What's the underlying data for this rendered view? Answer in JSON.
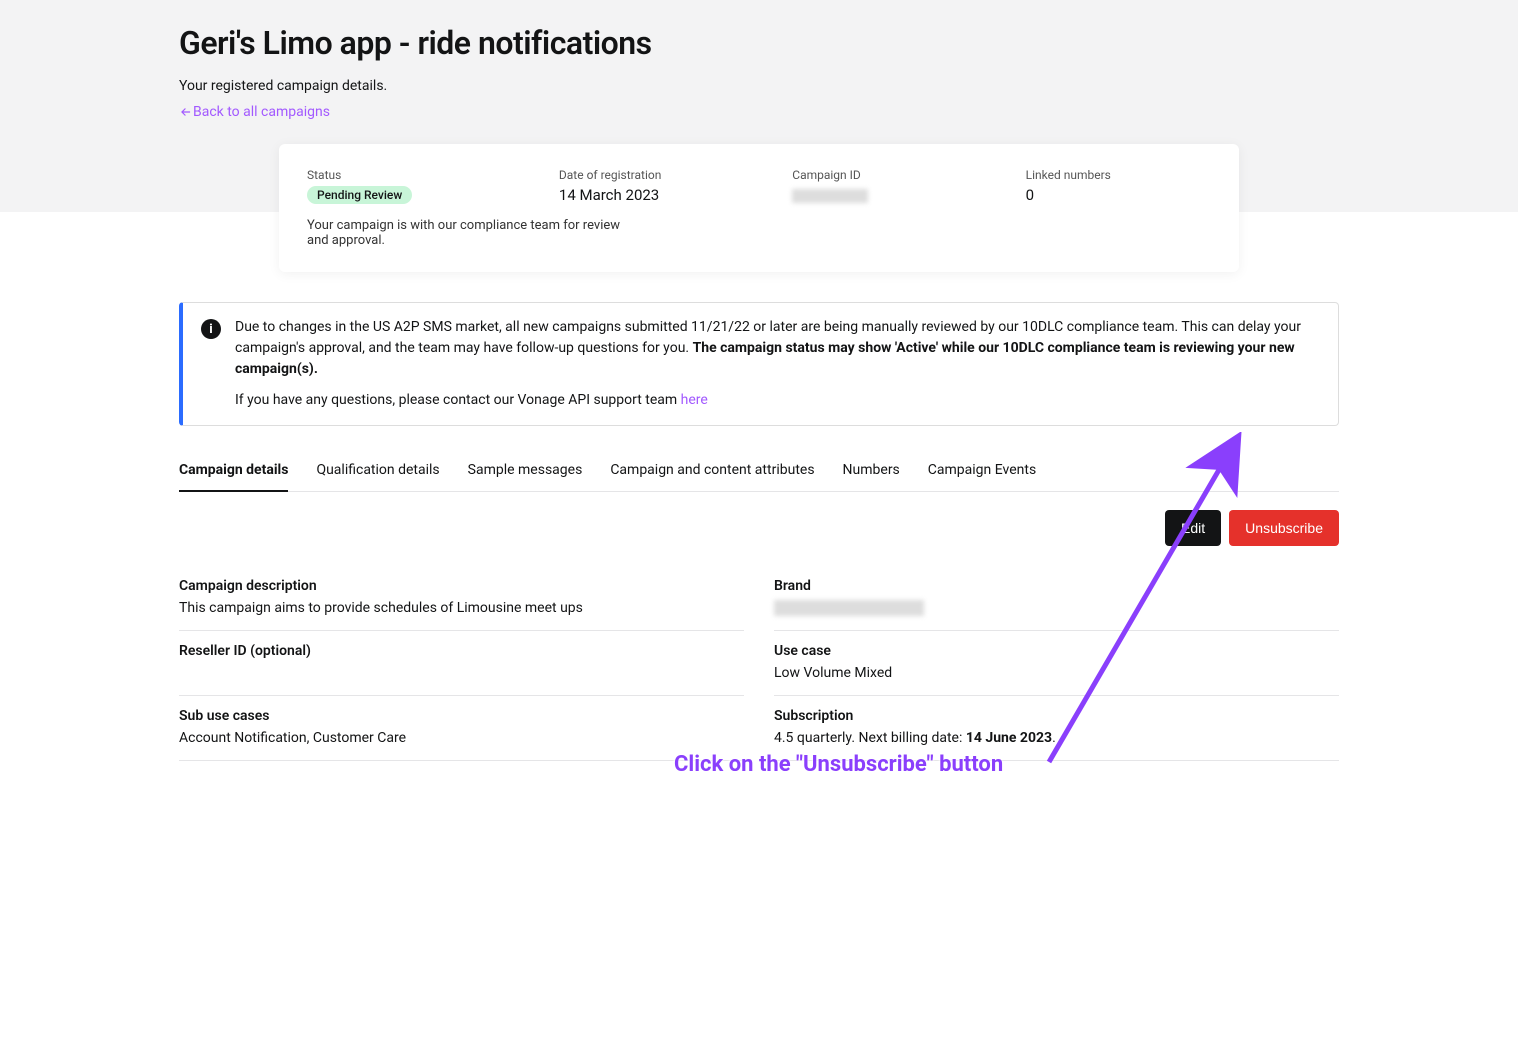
{
  "header": {
    "title": "Geri's Limo app - ride notifications",
    "subtitle": "Your registered campaign details.",
    "back_link": "Back to all campaigns"
  },
  "summary": {
    "status_label": "Status",
    "status_value": "Pending Review",
    "date_label": "Date of registration",
    "date_value": "14 March 2023",
    "campaign_id_label": "Campaign ID",
    "linked_label": "Linked numbers",
    "linked_value": "0",
    "status_note": "Your campaign is with our compliance team for review and approval."
  },
  "banner": {
    "line1_a": "Due to changes in the US A2P SMS market, all new campaigns submitted 11/21/22 or later are being manually reviewed by our 10DLC compliance team. This can delay your campaign's approval, and the team may have follow-up questions for you. ",
    "line1_b": "The campaign status may show 'Active' while our 10DLC compliance team is reviewing your new campaign(s).",
    "line2": "If you have any questions, please contact our Vonage API support team ",
    "link": "here"
  },
  "tabs": [
    {
      "label": "Campaign details",
      "active": true
    },
    {
      "label": "Qualification details",
      "active": false
    },
    {
      "label": "Sample messages",
      "active": false
    },
    {
      "label": "Campaign and content attributes",
      "active": false
    },
    {
      "label": "Numbers",
      "active": false
    },
    {
      "label": "Campaign Events",
      "active": false
    }
  ],
  "actions": {
    "edit": "Edit",
    "unsubscribe": "Unsubscribe"
  },
  "details": {
    "campaign_description_label": "Campaign description",
    "campaign_description_value": "This campaign aims to provide schedules of Limousine meet ups",
    "brand_label": "Brand",
    "reseller_label": "Reseller ID (optional)",
    "reseller_value": "",
    "usecase_label": "Use case",
    "usecase_value": "Low Volume Mixed",
    "sub_usecase_label": "Sub use cases",
    "sub_usecase_value": "Account Notification, Customer Care",
    "subscription_label": "Subscription",
    "subscription_value_a": "4.5 quarterly. Next billing date: ",
    "subscription_value_b": "14 June 2023",
    "subscription_value_c": "."
  },
  "annotation": {
    "text": "Click on the \"Unsubscribe\" button"
  }
}
